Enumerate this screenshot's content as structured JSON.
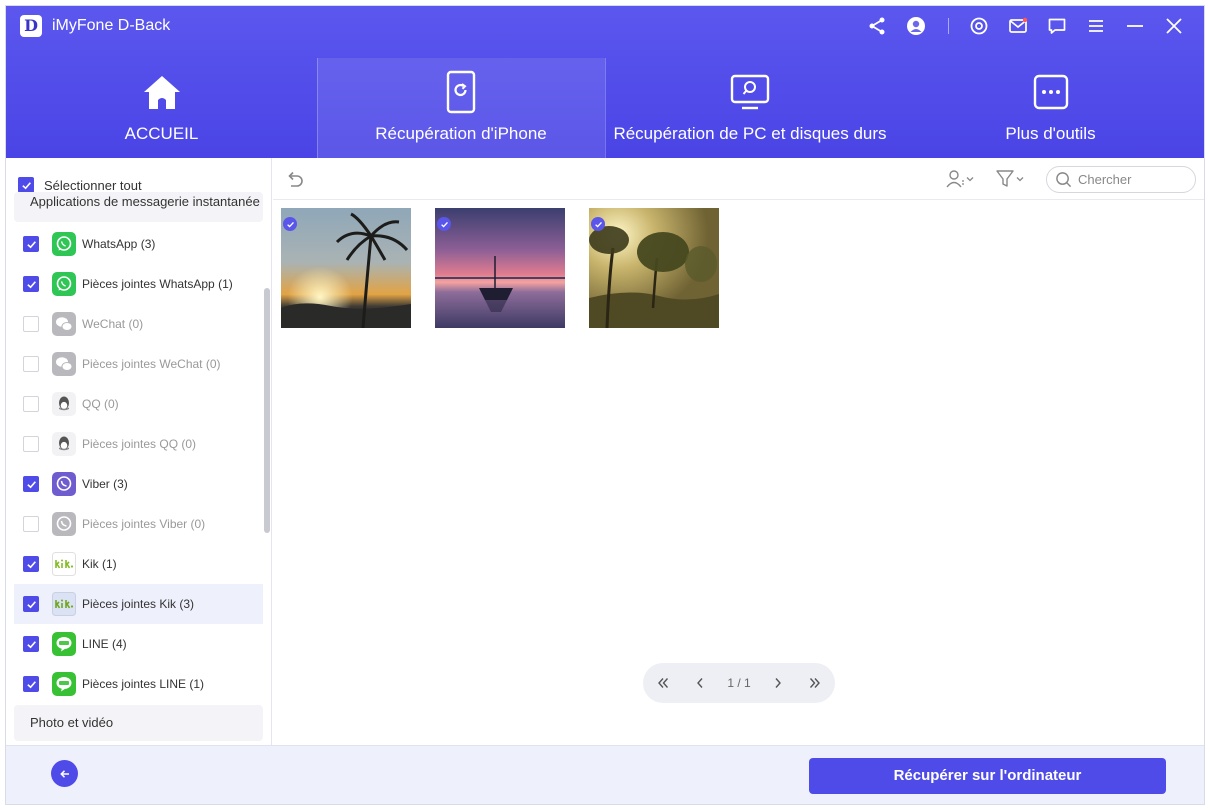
{
  "app": {
    "logo_letter": "D",
    "title": "iMyFone D-Back"
  },
  "titlebar_icons": [
    "share-icon",
    "account-icon",
    "settings-icon",
    "mail-icon",
    "feedback-icon",
    "menu-icon",
    "minimize-icon",
    "close-icon"
  ],
  "nav": {
    "tabs": [
      {
        "label": "ACCUEIL",
        "icon": "home-icon",
        "active": false
      },
      {
        "label": "Récupération d'iPhone",
        "icon": "iphone-recovery-icon",
        "active": true
      },
      {
        "label": "Récupération de PC et disques durs",
        "icon": "pc-recovery-icon",
        "active": false
      },
      {
        "label": "Plus d'outils",
        "icon": "more-tools-icon",
        "active": false
      }
    ]
  },
  "sidebar": {
    "select_all_label": "Sélectionner tout",
    "select_all_checked": true,
    "section_top": "Applications de messagerie instantanée",
    "items": [
      {
        "label": "WhatsApp (3)",
        "icon": "whatsapp-icon",
        "checked": true,
        "disabled": false
      },
      {
        "label": "Pièces jointes WhatsApp (1)",
        "icon": "whatsapp-icon",
        "checked": true,
        "disabled": false
      },
      {
        "label": "WeChat (0)",
        "icon": "wechat-icon",
        "checked": false,
        "disabled": true
      },
      {
        "label": "Pièces jointes WeChat (0)",
        "icon": "wechat-icon",
        "checked": false,
        "disabled": true
      },
      {
        "label": "QQ (0)",
        "icon": "qq-icon",
        "checked": false,
        "disabled": true
      },
      {
        "label": "Pièces jointes QQ (0)",
        "icon": "qq-icon",
        "checked": false,
        "disabled": true
      },
      {
        "label": "Viber (3)",
        "icon": "viber-icon",
        "checked": true,
        "disabled": false
      },
      {
        "label": "Pièces jointes Viber (0)",
        "icon": "viber-icon",
        "checked": false,
        "disabled": true
      },
      {
        "label": "Kik (1)",
        "icon": "kik-icon",
        "checked": true,
        "disabled": false
      },
      {
        "label": "Pièces jointes Kik (3)",
        "icon": "kik-icon",
        "checked": true,
        "disabled": false,
        "selected": true
      },
      {
        "label": "LINE (4)",
        "icon": "line-icon",
        "checked": true,
        "disabled": false
      },
      {
        "label": "Pièces jointes LINE (1)",
        "icon": "line-icon",
        "checked": true,
        "disabled": false
      }
    ],
    "section_bottom": "Photo et vidéo"
  },
  "toolbar": {
    "search_placeholder": "Chercher"
  },
  "thumbnails": [
    {
      "name": "sunset-palm-photo",
      "checked": true
    },
    {
      "name": "boat-dusk-photo",
      "checked": true
    },
    {
      "name": "misty-trees-photo",
      "checked": true
    }
  ],
  "pager": {
    "text": "1 / 1"
  },
  "footer": {
    "recover_label": "Récupérer sur l'ordinateur"
  },
  "colors": {
    "accent": "#4f4be8",
    "header": "#5b57ee",
    "whatsapp": "#25d366",
    "line": "#38c135",
    "kik": "#82bc23",
    "viber": "#6f5ccf"
  }
}
